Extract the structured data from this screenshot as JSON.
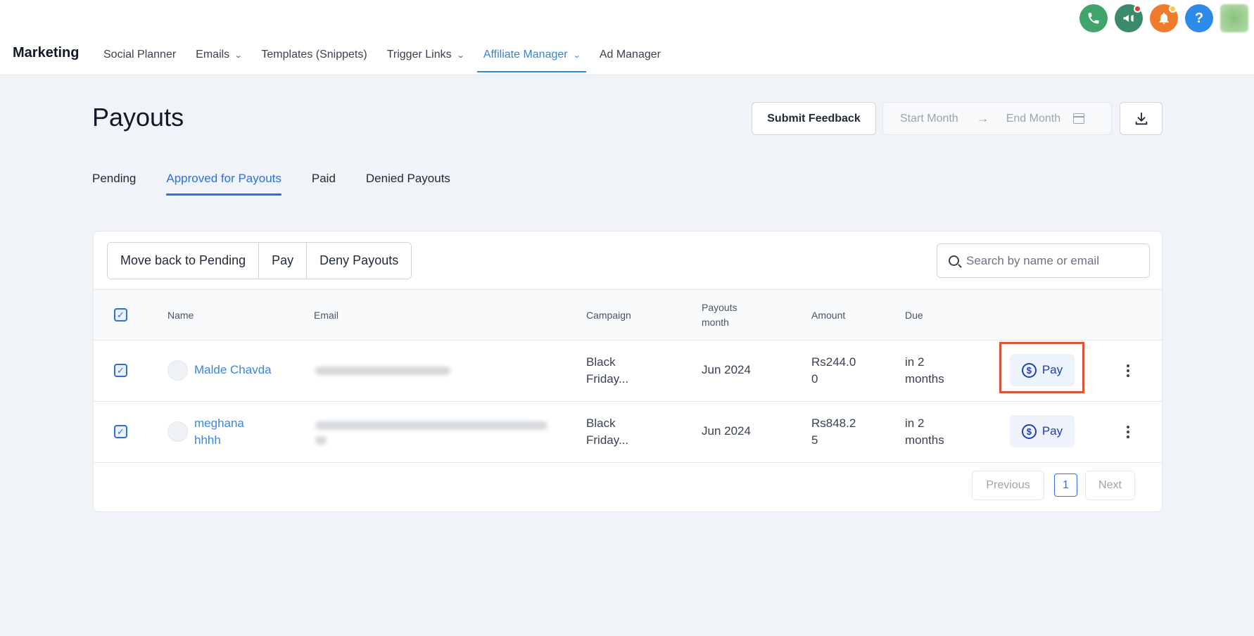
{
  "app": {
    "brand": "Marketing",
    "nav": [
      {
        "label": "Social Planner",
        "has_dropdown": false,
        "active": false
      },
      {
        "label": "Emails",
        "has_dropdown": true,
        "active": false
      },
      {
        "label": "Templates (Snippets)",
        "has_dropdown": false,
        "active": false
      },
      {
        "label": "Trigger Links",
        "has_dropdown": true,
        "active": false
      },
      {
        "label": "Affiliate Manager",
        "has_dropdown": true,
        "active": true
      },
      {
        "label": "Ad Manager",
        "has_dropdown": false,
        "active": false
      }
    ],
    "top_icons": [
      "phone-icon",
      "megaphone-icon",
      "bell-icon",
      "help-icon",
      "user-avatar"
    ],
    "help_glyph": "?"
  },
  "page": {
    "title": "Payouts",
    "submit_feedback": "Submit Feedback",
    "start_month_placeholder": "Start Month",
    "end_month_placeholder": "End Month",
    "tabs": [
      "Pending",
      "Approved for Payouts",
      "Paid",
      "Denied Payouts"
    ],
    "active_tab": "Approved for Payouts"
  },
  "toolbar": {
    "move_back": "Move back to Pending",
    "pay": "Pay",
    "deny": "Deny Payouts",
    "search_placeholder": "Search by name or email"
  },
  "table": {
    "headers": {
      "name": "Name",
      "email": "Email",
      "campaign": "Campaign",
      "payouts_month_1": "Payouts",
      "payouts_month_2": "month",
      "amount": "Amount",
      "due": "Due"
    },
    "rows": [
      {
        "name_1": "Malde Chavda",
        "name_2": "",
        "campaign_1": "Black",
        "campaign_2": "Friday...",
        "month": "Jun 2024",
        "amount_1": "Rs244.0",
        "amount_2": "0",
        "due_1": "in 2",
        "due_2": "months",
        "pay_label": "Pay",
        "checked": true
      },
      {
        "name_1": "meghana",
        "name_2": "hhhh",
        "campaign_1": "Black",
        "campaign_2": "Friday...",
        "month": "Jun 2024",
        "amount_1": "Rs848.2",
        "amount_2": "5",
        "due_1": "in 2",
        "due_2": "months",
        "pay_label": "Pay",
        "checked": true
      }
    ]
  },
  "pagination": {
    "previous": "Previous",
    "current_page": "1",
    "next": "Next"
  },
  "colors": {
    "accent": "#2f6fd6",
    "link": "#3b86d8",
    "highlight": "#d9553a"
  }
}
